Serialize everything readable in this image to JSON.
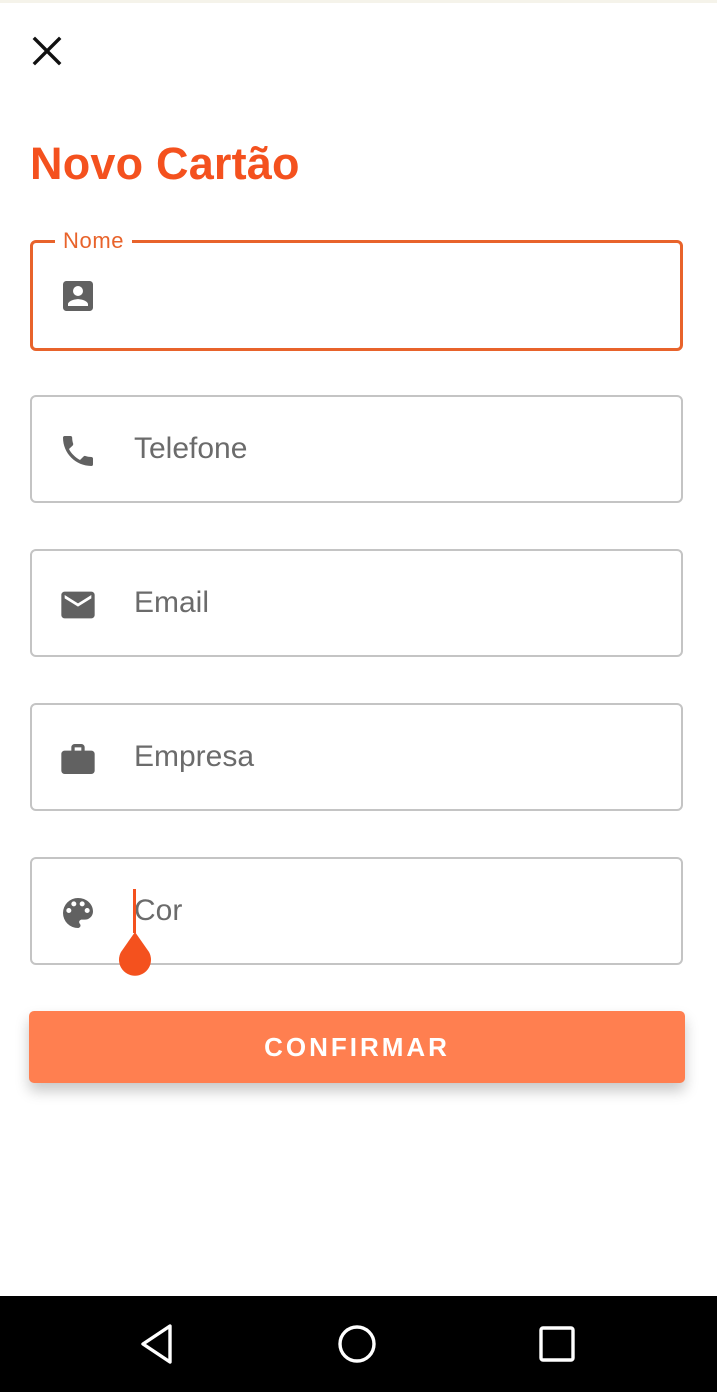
{
  "header": {
    "close_icon": "close-icon",
    "title": "Novo Cartão"
  },
  "form": {
    "nome": {
      "label": "Nome",
      "value": "",
      "placeholder": "",
      "icon": "contact-card-icon"
    },
    "telefone": {
      "placeholder": "Telefone",
      "value": "",
      "icon": "phone-icon"
    },
    "email": {
      "placeholder": "Email",
      "value": "",
      "icon": "email-icon"
    },
    "empresa": {
      "placeholder": "Empresa",
      "value": "",
      "icon": "briefcase-icon"
    },
    "cor": {
      "placeholder": "Cor",
      "value": "",
      "icon": "palette-icon"
    }
  },
  "actions": {
    "confirm_label": "CONFIRMAR"
  },
  "navigation": {
    "icons": [
      "back-triangle-icon",
      "home-circle-icon",
      "recents-square-icon"
    ]
  },
  "colors": {
    "accent": "#f4511e",
    "focus_border": "#e8632b",
    "button": "#ff7f50",
    "icon": "#616161",
    "border": "#c4c4c4"
  }
}
